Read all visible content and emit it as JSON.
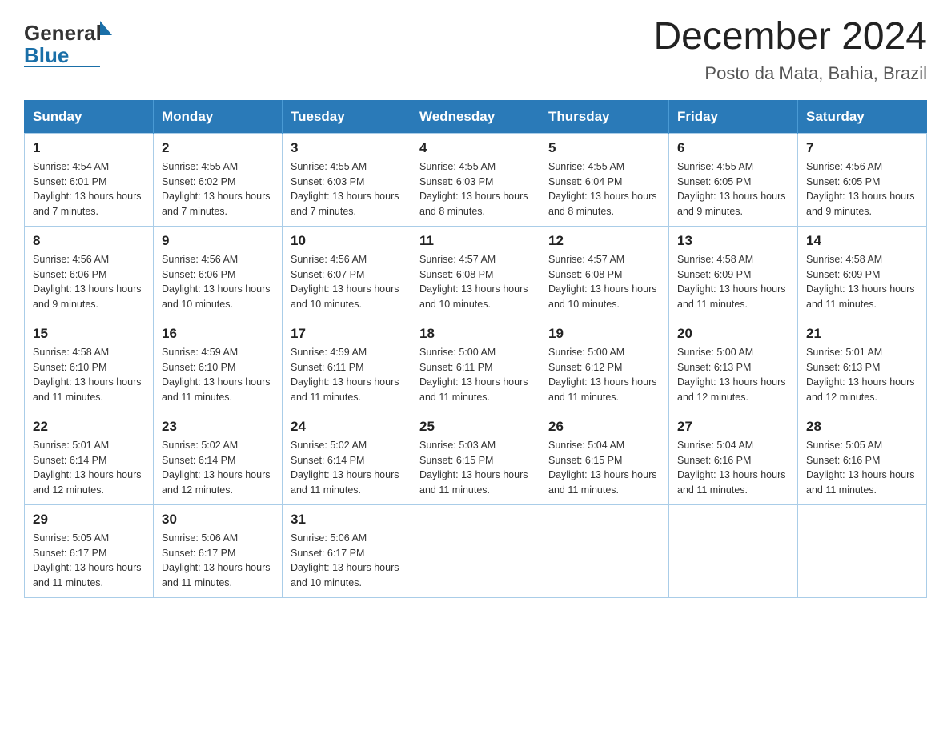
{
  "header": {
    "logo_general": "General",
    "logo_blue": "Blue",
    "title": "December 2024",
    "subtitle": "Posto da Mata, Bahia, Brazil"
  },
  "days_of_week": [
    "Sunday",
    "Monday",
    "Tuesday",
    "Wednesday",
    "Thursday",
    "Friday",
    "Saturday"
  ],
  "weeks": [
    [
      {
        "day": "1",
        "sunrise": "4:54 AM",
        "sunset": "6:01 PM",
        "daylight": "13 hours and 7 minutes."
      },
      {
        "day": "2",
        "sunrise": "4:55 AM",
        "sunset": "6:02 PM",
        "daylight": "13 hours and 7 minutes."
      },
      {
        "day": "3",
        "sunrise": "4:55 AM",
        "sunset": "6:03 PM",
        "daylight": "13 hours and 7 minutes."
      },
      {
        "day": "4",
        "sunrise": "4:55 AM",
        "sunset": "6:03 PM",
        "daylight": "13 hours and 8 minutes."
      },
      {
        "day": "5",
        "sunrise": "4:55 AM",
        "sunset": "6:04 PM",
        "daylight": "13 hours and 8 minutes."
      },
      {
        "day": "6",
        "sunrise": "4:55 AM",
        "sunset": "6:05 PM",
        "daylight": "13 hours and 9 minutes."
      },
      {
        "day": "7",
        "sunrise": "4:56 AM",
        "sunset": "6:05 PM",
        "daylight": "13 hours and 9 minutes."
      }
    ],
    [
      {
        "day": "8",
        "sunrise": "4:56 AM",
        "sunset": "6:06 PM",
        "daylight": "13 hours and 9 minutes."
      },
      {
        "day": "9",
        "sunrise": "4:56 AM",
        "sunset": "6:06 PM",
        "daylight": "13 hours and 10 minutes."
      },
      {
        "day": "10",
        "sunrise": "4:56 AM",
        "sunset": "6:07 PM",
        "daylight": "13 hours and 10 minutes."
      },
      {
        "day": "11",
        "sunrise": "4:57 AM",
        "sunset": "6:08 PM",
        "daylight": "13 hours and 10 minutes."
      },
      {
        "day": "12",
        "sunrise": "4:57 AM",
        "sunset": "6:08 PM",
        "daylight": "13 hours and 10 minutes."
      },
      {
        "day": "13",
        "sunrise": "4:58 AM",
        "sunset": "6:09 PM",
        "daylight": "13 hours and 11 minutes."
      },
      {
        "day": "14",
        "sunrise": "4:58 AM",
        "sunset": "6:09 PM",
        "daylight": "13 hours and 11 minutes."
      }
    ],
    [
      {
        "day": "15",
        "sunrise": "4:58 AM",
        "sunset": "6:10 PM",
        "daylight": "13 hours and 11 minutes."
      },
      {
        "day": "16",
        "sunrise": "4:59 AM",
        "sunset": "6:10 PM",
        "daylight": "13 hours and 11 minutes."
      },
      {
        "day": "17",
        "sunrise": "4:59 AM",
        "sunset": "6:11 PM",
        "daylight": "13 hours and 11 minutes."
      },
      {
        "day": "18",
        "sunrise": "5:00 AM",
        "sunset": "6:11 PM",
        "daylight": "13 hours and 11 minutes."
      },
      {
        "day": "19",
        "sunrise": "5:00 AM",
        "sunset": "6:12 PM",
        "daylight": "13 hours and 11 minutes."
      },
      {
        "day": "20",
        "sunrise": "5:00 AM",
        "sunset": "6:13 PM",
        "daylight": "13 hours and 12 minutes."
      },
      {
        "day": "21",
        "sunrise": "5:01 AM",
        "sunset": "6:13 PM",
        "daylight": "13 hours and 12 minutes."
      }
    ],
    [
      {
        "day": "22",
        "sunrise": "5:01 AM",
        "sunset": "6:14 PM",
        "daylight": "13 hours and 12 minutes."
      },
      {
        "day": "23",
        "sunrise": "5:02 AM",
        "sunset": "6:14 PM",
        "daylight": "13 hours and 12 minutes."
      },
      {
        "day": "24",
        "sunrise": "5:02 AM",
        "sunset": "6:14 PM",
        "daylight": "13 hours and 11 minutes."
      },
      {
        "day": "25",
        "sunrise": "5:03 AM",
        "sunset": "6:15 PM",
        "daylight": "13 hours and 11 minutes."
      },
      {
        "day": "26",
        "sunrise": "5:04 AM",
        "sunset": "6:15 PM",
        "daylight": "13 hours and 11 minutes."
      },
      {
        "day": "27",
        "sunrise": "5:04 AM",
        "sunset": "6:16 PM",
        "daylight": "13 hours and 11 minutes."
      },
      {
        "day": "28",
        "sunrise": "5:05 AM",
        "sunset": "6:16 PM",
        "daylight": "13 hours and 11 minutes."
      }
    ],
    [
      {
        "day": "29",
        "sunrise": "5:05 AM",
        "sunset": "6:17 PM",
        "daylight": "13 hours and 11 minutes."
      },
      {
        "day": "30",
        "sunrise": "5:06 AM",
        "sunset": "6:17 PM",
        "daylight": "13 hours and 11 minutes."
      },
      {
        "day": "31",
        "sunrise": "5:06 AM",
        "sunset": "6:17 PM",
        "daylight": "13 hours and 10 minutes."
      },
      null,
      null,
      null,
      null
    ]
  ],
  "labels": {
    "sunrise": "Sunrise:",
    "sunset": "Sunset:",
    "daylight": "Daylight:"
  }
}
